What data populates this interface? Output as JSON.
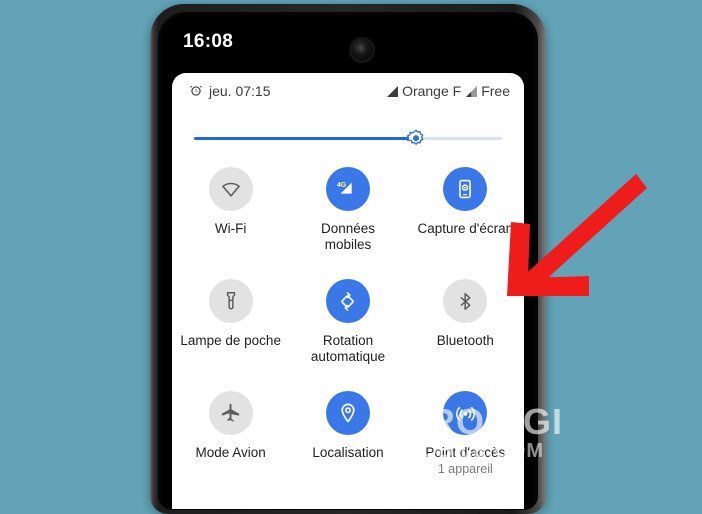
{
  "background_color": "#63a3b8",
  "phone": {
    "status_bar": {
      "clock": "16:08",
      "camera_icon": "front-camera-punch-hole"
    },
    "quick_settings": {
      "alarm_icon": "alarm-clock-icon",
      "alarm_text": "jeu. 07:15",
      "carriers": [
        {
          "name": "Orange F",
          "signal_icon": "signal-bars-full"
        },
        {
          "name": "Free",
          "signal_icon": "signal-bars-partial"
        }
      ],
      "brightness": {
        "label": "brightness-slider",
        "value_percent": 72,
        "knob_icon": "brightness-sun-icon",
        "fill_color": "#1a6ae0",
        "track_color": "#d6e2f7"
      },
      "tiles": [
        [
          {
            "label": "Wi-Fi",
            "sub": "",
            "state": "off",
            "icon": "wifi-icon"
          },
          {
            "label": "Données mobiles",
            "sub": "",
            "state": "on",
            "icon": "mobile-data-4g-icon"
          },
          {
            "label": "Capture d'écran",
            "sub": "",
            "state": "on",
            "icon": "screenshot-icon"
          }
        ],
        [
          {
            "label": "Lampe de poche",
            "sub": "",
            "state": "off",
            "icon": "flashlight-icon"
          },
          {
            "label": "Rotation automatique",
            "sub": "",
            "state": "on",
            "icon": "auto-rotate-icon"
          },
          {
            "label": "Bluetooth",
            "sub": "",
            "state": "off",
            "icon": "bluetooth-icon"
          }
        ],
        [
          {
            "label": "Mode Avion",
            "sub": "",
            "state": "off",
            "icon": "airplane-icon"
          },
          {
            "label": "Localisation",
            "sub": "",
            "state": "on",
            "icon": "location-pin-icon"
          },
          {
            "label": "Point d'accès",
            "sub": "1 appareil",
            "state": "on",
            "icon": "hotspot-icon"
          }
        ]
      ]
    }
  },
  "annotation": {
    "arrow_icon": "red-arrow-down-left",
    "arrow_color": "#ef1c1c",
    "points_at": "Bluetooth"
  },
  "watermark": {
    "line1": "PRODIGI",
    "line2": "MOBILE.COM"
  }
}
